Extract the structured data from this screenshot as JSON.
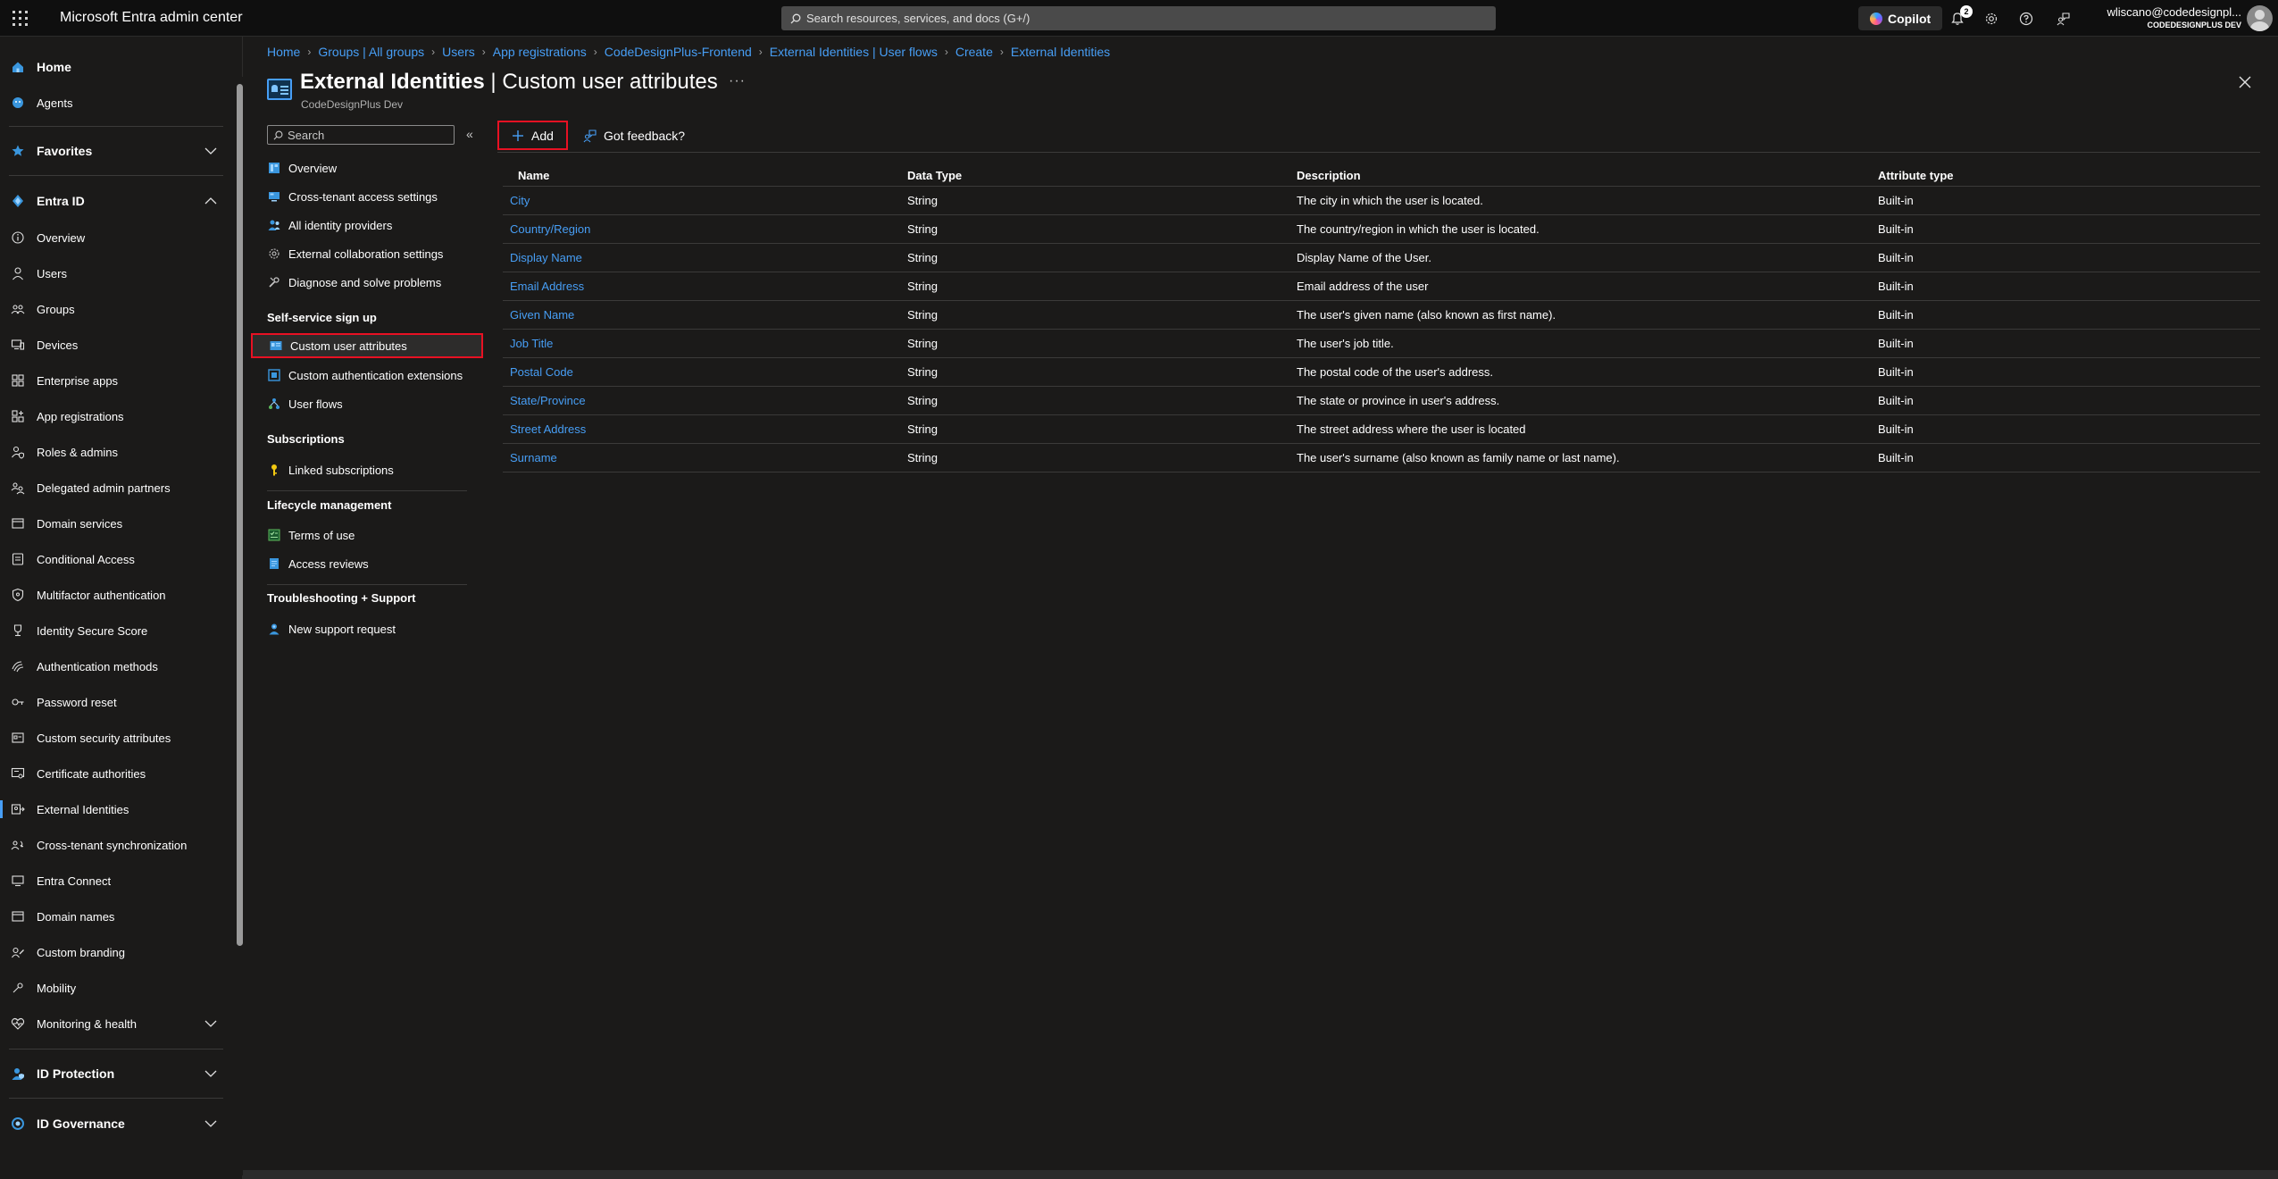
{
  "app": {
    "title": "Microsoft Entra admin center"
  },
  "search": {
    "placeholder": "Search resources, services, and docs (G+/)"
  },
  "topbar": {
    "copilot_label": "Copilot",
    "notification_count": "2"
  },
  "user": {
    "name": "wliscano@codedesignpl...",
    "org": "CODEDESIGNPLUS DEV"
  },
  "leftnav": {
    "items": [
      {
        "label": "Home",
        "icon": "home-icon"
      },
      {
        "label": "Agents",
        "icon": "agents-icon"
      },
      {
        "label": "Favorites",
        "icon": "star-icon"
      },
      {
        "label": "Entra ID",
        "icon": "entra-icon"
      },
      {
        "label": "Overview",
        "icon": "info-icon"
      },
      {
        "label": "Users",
        "icon": "user-icon"
      },
      {
        "label": "Groups",
        "icon": "groups-icon"
      },
      {
        "label": "Devices",
        "icon": "devices-icon"
      },
      {
        "label": "Enterprise apps",
        "icon": "apps-icon"
      },
      {
        "label": "App registrations",
        "icon": "app-registrations-icon"
      },
      {
        "label": "Roles & admins",
        "icon": "roles-icon"
      },
      {
        "label": "Delegated admin partners",
        "icon": "partners-icon"
      },
      {
        "label": "Domain services",
        "icon": "domain-services-icon"
      },
      {
        "label": "Conditional Access",
        "icon": "conditional-access-icon"
      },
      {
        "label": "Multifactor authentication",
        "icon": "mfa-icon"
      },
      {
        "label": "Identity Secure Score",
        "icon": "trophy-icon"
      },
      {
        "label": "Authentication methods",
        "icon": "auth-methods-icon"
      },
      {
        "label": "Password reset",
        "icon": "key-icon"
      },
      {
        "label": "Custom security attributes",
        "icon": "attributes-icon"
      },
      {
        "label": "Certificate authorities",
        "icon": "certificate-icon"
      },
      {
        "label": "External Identities",
        "icon": "external-identities-icon"
      },
      {
        "label": "Cross-tenant synchronization",
        "icon": "sync-icon"
      },
      {
        "label": "Entra Connect",
        "icon": "connect-icon"
      },
      {
        "label": "Domain names",
        "icon": "domain-icon"
      },
      {
        "label": "Custom branding",
        "icon": "branding-icon"
      },
      {
        "label": "Mobility",
        "icon": "mobility-icon"
      },
      {
        "label": "Monitoring & health",
        "icon": "monitoring-icon"
      },
      {
        "label": "ID Protection",
        "icon": "id-protection-icon"
      },
      {
        "label": "ID Governance",
        "icon": "id-governance-icon"
      }
    ]
  },
  "breadcrumb": [
    "Home",
    "Groups | All groups",
    "Users",
    "App registrations",
    "CodeDesignPlus-Frontend",
    "External Identities | User flows",
    "Create",
    "External Identities"
  ],
  "page": {
    "title_main": "External Identities",
    "title_sep": " | ",
    "title_sub": "Custom user attributes",
    "subtitle": "CodeDesignPlus Dev"
  },
  "blade_menu": {
    "search_placeholder": "Search",
    "items": [
      "Overview",
      "Cross-tenant access settings",
      "All identity providers",
      "External collaboration settings",
      "Diagnose and solve problems"
    ],
    "sections": [
      {
        "title": "Self-service sign up",
        "items": [
          "Custom user attributes",
          "Custom authentication extensions",
          "User flows"
        ]
      },
      {
        "title": "Subscriptions",
        "items": [
          "Linked subscriptions"
        ]
      },
      {
        "title": "Lifecycle management",
        "items": [
          "Terms of use",
          "Access reviews"
        ]
      },
      {
        "title": "Troubleshooting + Support",
        "items": [
          "New support request"
        ]
      }
    ]
  },
  "commands": {
    "add_label": "Add",
    "feedback_label": "Got feedback?"
  },
  "table": {
    "columns": [
      "Name",
      "Data Type",
      "Description",
      "Attribute type"
    ],
    "rows": [
      [
        "City",
        "String",
        "The city in which the user is located.",
        "Built-in"
      ],
      [
        "Country/Region",
        "String",
        "The country/region in which the user is located.",
        "Built-in"
      ],
      [
        "Display Name",
        "String",
        "Display Name of the User.",
        "Built-in"
      ],
      [
        "Email Address",
        "String",
        "Email address of the user",
        "Built-in"
      ],
      [
        "Given Name",
        "String",
        "The user's given name (also known as first name).",
        "Built-in"
      ],
      [
        "Job Title",
        "String",
        "The user's job title.",
        "Built-in"
      ],
      [
        "Postal Code",
        "String",
        "The postal code of the user's address.",
        "Built-in"
      ],
      [
        "State/Province",
        "String",
        "The state or province in user's address.",
        "Built-in"
      ],
      [
        "Street Address",
        "String",
        "The street address where the user is located",
        "Built-in"
      ],
      [
        "Surname",
        "String",
        "The user's surname (also known as family name or last name).",
        "Built-in"
      ]
    ]
  },
  "colors": {
    "accent": "#479ef5",
    "highlight": "#e81123",
    "background": "#1b1a19",
    "topbar": "#0f0f0f"
  }
}
